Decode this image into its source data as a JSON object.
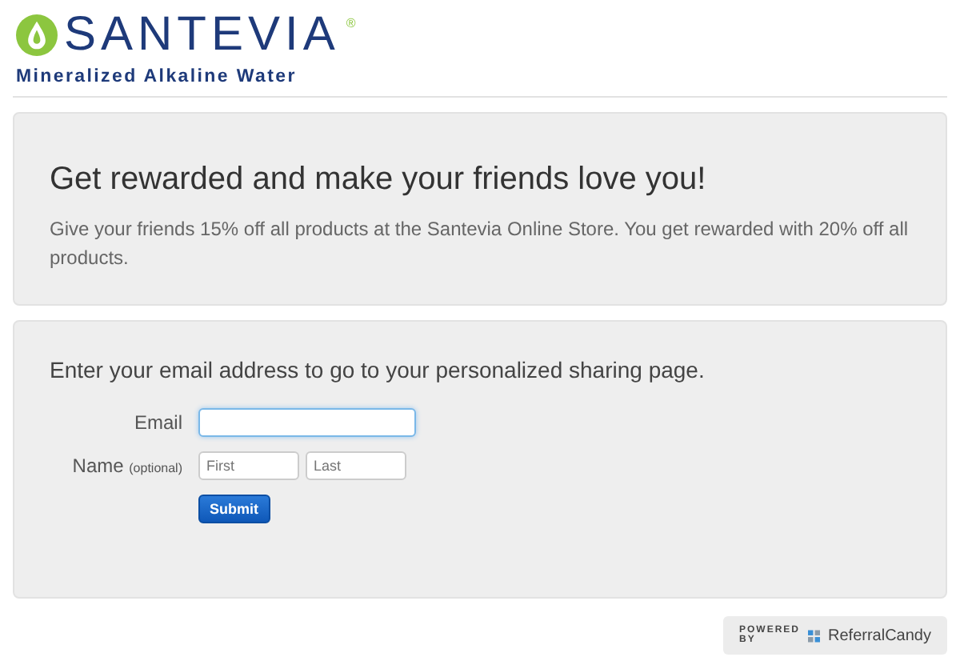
{
  "logo": {
    "brand": "SANTEVIA",
    "registered": "®",
    "tagline": "Mineralized Alkaline Water"
  },
  "hero": {
    "title": "Get rewarded and make your friends love you!",
    "text": "Give your friends 15% off all products at the Santevia Online Store. You get rewarded with 20% off all products."
  },
  "form": {
    "intro": "Enter your email address to go to your personalized sharing page.",
    "email_label": "Email",
    "name_label": "Name",
    "name_hint": "(optional)",
    "first_placeholder": "First",
    "last_placeholder": "Last",
    "submit": "Submit"
  },
  "footer": {
    "powered_by": "POWERED BY",
    "brand": "ReferralCandy"
  }
}
